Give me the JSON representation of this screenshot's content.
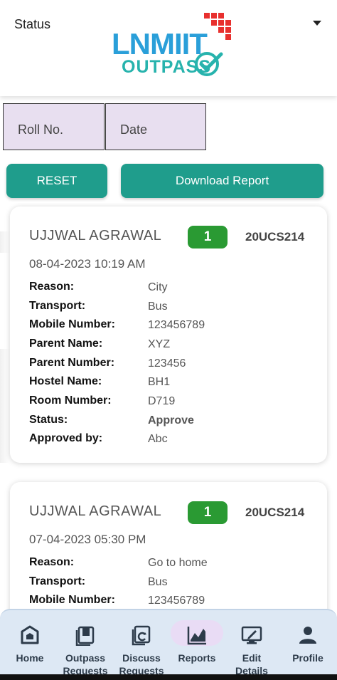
{
  "logo": {
    "line1": "LNMIIT",
    "line2": "OUTPASS"
  },
  "filters": {
    "roll_label": "Roll No.",
    "date_label": "Date",
    "status_label": "Status"
  },
  "buttons": {
    "reset": "RESET",
    "download": "Download Report"
  },
  "cards": [
    {
      "name": "UJJWAL AGRAWAL",
      "badge": "1",
      "roll": "20UCS214",
      "datetime": "08-04-2023 10:19 AM",
      "rows": [
        {
          "label": "Reason:",
          "value": "City"
        },
        {
          "label": "Transport:",
          "value": "Bus"
        },
        {
          "label": "Mobile Number:",
          "value": "123456789"
        },
        {
          "label": "Parent Name:",
          "value": "XYZ"
        },
        {
          "label": "Parent Number:",
          "value": "123456"
        },
        {
          "label": "Hostel Name:",
          "value": "BH1"
        },
        {
          "label": "Room Number:",
          "value": "D719"
        },
        {
          "label": "Status:",
          "value": "Approve"
        },
        {
          "label": "Approved by:",
          "value": "Abc"
        }
      ]
    },
    {
      "name": "UJJWAL AGRAWAL",
      "badge": "1",
      "roll": "20UCS214",
      "datetime": "07-04-2023 05:30 PM",
      "rows": [
        {
          "label": "Reason:",
          "value": "Go to home"
        },
        {
          "label": "Transport:",
          "value": "Bus"
        },
        {
          "label": "Mobile Number:",
          "value": "123456789"
        }
      ]
    }
  ],
  "nav": [
    {
      "label": "Home",
      "icon": "home-icon"
    },
    {
      "label": "Outpass Requests",
      "icon": "outpass-icon"
    },
    {
      "label": "Discuss Requests",
      "icon": "discuss-icon"
    },
    {
      "label": "Reports",
      "icon": "reports-chart-icon",
      "active": true
    },
    {
      "label": "Edit Details",
      "icon": "edit-monitor-icon"
    },
    {
      "label": "Profile",
      "icon": "profile-icon"
    }
  ],
  "colors": {
    "accent": "#1f9d8c",
    "badge": "#2a9a33",
    "nav_bg": "#dde8f4",
    "active_pill": "#e9dcf5",
    "filter_bg": "#e8dff0"
  }
}
